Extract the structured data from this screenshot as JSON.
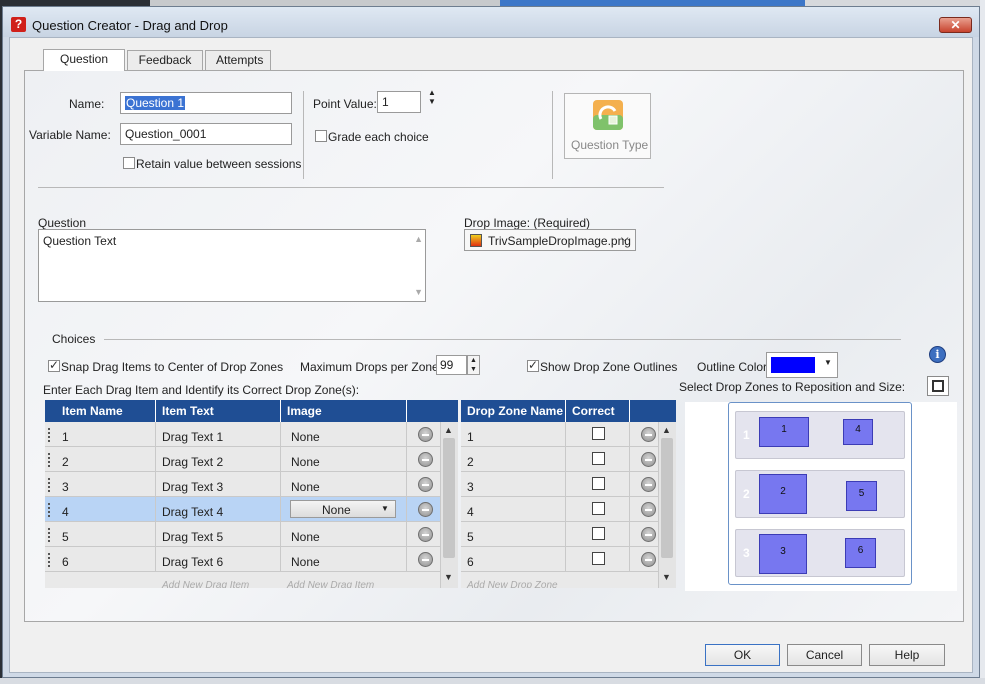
{
  "window": {
    "title": "Question Creator - Drag and Drop",
    "close_glyph": "✕",
    "icon_glyph": "?"
  },
  "tabs": [
    {
      "label": "Question",
      "active": true
    },
    {
      "label": "Feedback",
      "active": false
    },
    {
      "label": "Attempts",
      "active": false
    }
  ],
  "form": {
    "name_label": "Name:",
    "name_value": "Question 1",
    "variable_label": "Variable Name:",
    "variable_value": "Question_0001",
    "retain_label": "Retain value between sessions",
    "retain_checked": false,
    "point_value_label": "Point Value:",
    "point_value": "1",
    "grade_each_label": "Grade each choice",
    "grade_each_checked": false,
    "question_type_label": "Question Type",
    "question_label": "Question",
    "question_text": "Question Text",
    "drop_image_label": "Drop Image: (Required)",
    "drop_image_value": "TrivSampleDropImage.png"
  },
  "choices": {
    "section_label": "Choices",
    "snap_label": "Snap Drag Items to Center of Drop Zones",
    "snap_checked": true,
    "max_drops_label": "Maximum Drops per Zone:",
    "max_drops_value": "99",
    "show_outlines_label": "Show Drop Zone Outlines",
    "show_outlines_checked": true,
    "outline_color_label": "Outline Color:",
    "outline_color": "#0000ff",
    "enter_label": "Enter Each Drag Item and Identify its Correct Drop Zone(s):",
    "select_zones_label": "Select Drop Zones to Reposition and Size:"
  },
  "drag_table": {
    "headers": [
      "Item Name",
      "Item Text",
      "Image"
    ],
    "rows": [
      {
        "name": "1",
        "text": "Drag Text 1",
        "image": "None",
        "selected": false
      },
      {
        "name": "2",
        "text": "Drag Text 2",
        "image": "None",
        "selected": false
      },
      {
        "name": "3",
        "text": "Drag Text 3",
        "image": "None",
        "selected": false
      },
      {
        "name": "4",
        "text": "Drag Text 4",
        "image": "None",
        "selected": true
      },
      {
        "name": "5",
        "text": "Drag Text 5",
        "image": "None",
        "selected": false
      },
      {
        "name": "6",
        "text": "Drag Text 6",
        "image": "None",
        "selected": false
      }
    ],
    "add_item_placeholder": "Add New Drag Item"
  },
  "zone_table": {
    "headers": [
      "Drop Zone Name",
      "Correct"
    ],
    "rows": [
      "1",
      "2",
      "3",
      "4",
      "5",
      "6"
    ],
    "add_zone_placeholder": "Add New Drop Zone"
  },
  "preview": {
    "rows": [
      {
        "label": "1",
        "zones": [
          "1",
          "4"
        ]
      },
      {
        "label": "2",
        "zones": [
          "2",
          "5"
        ]
      },
      {
        "label": "3",
        "zones": [
          "3",
          "6"
        ]
      }
    ]
  },
  "buttons": {
    "ok": "OK",
    "cancel": "Cancel",
    "help": "Help"
  }
}
